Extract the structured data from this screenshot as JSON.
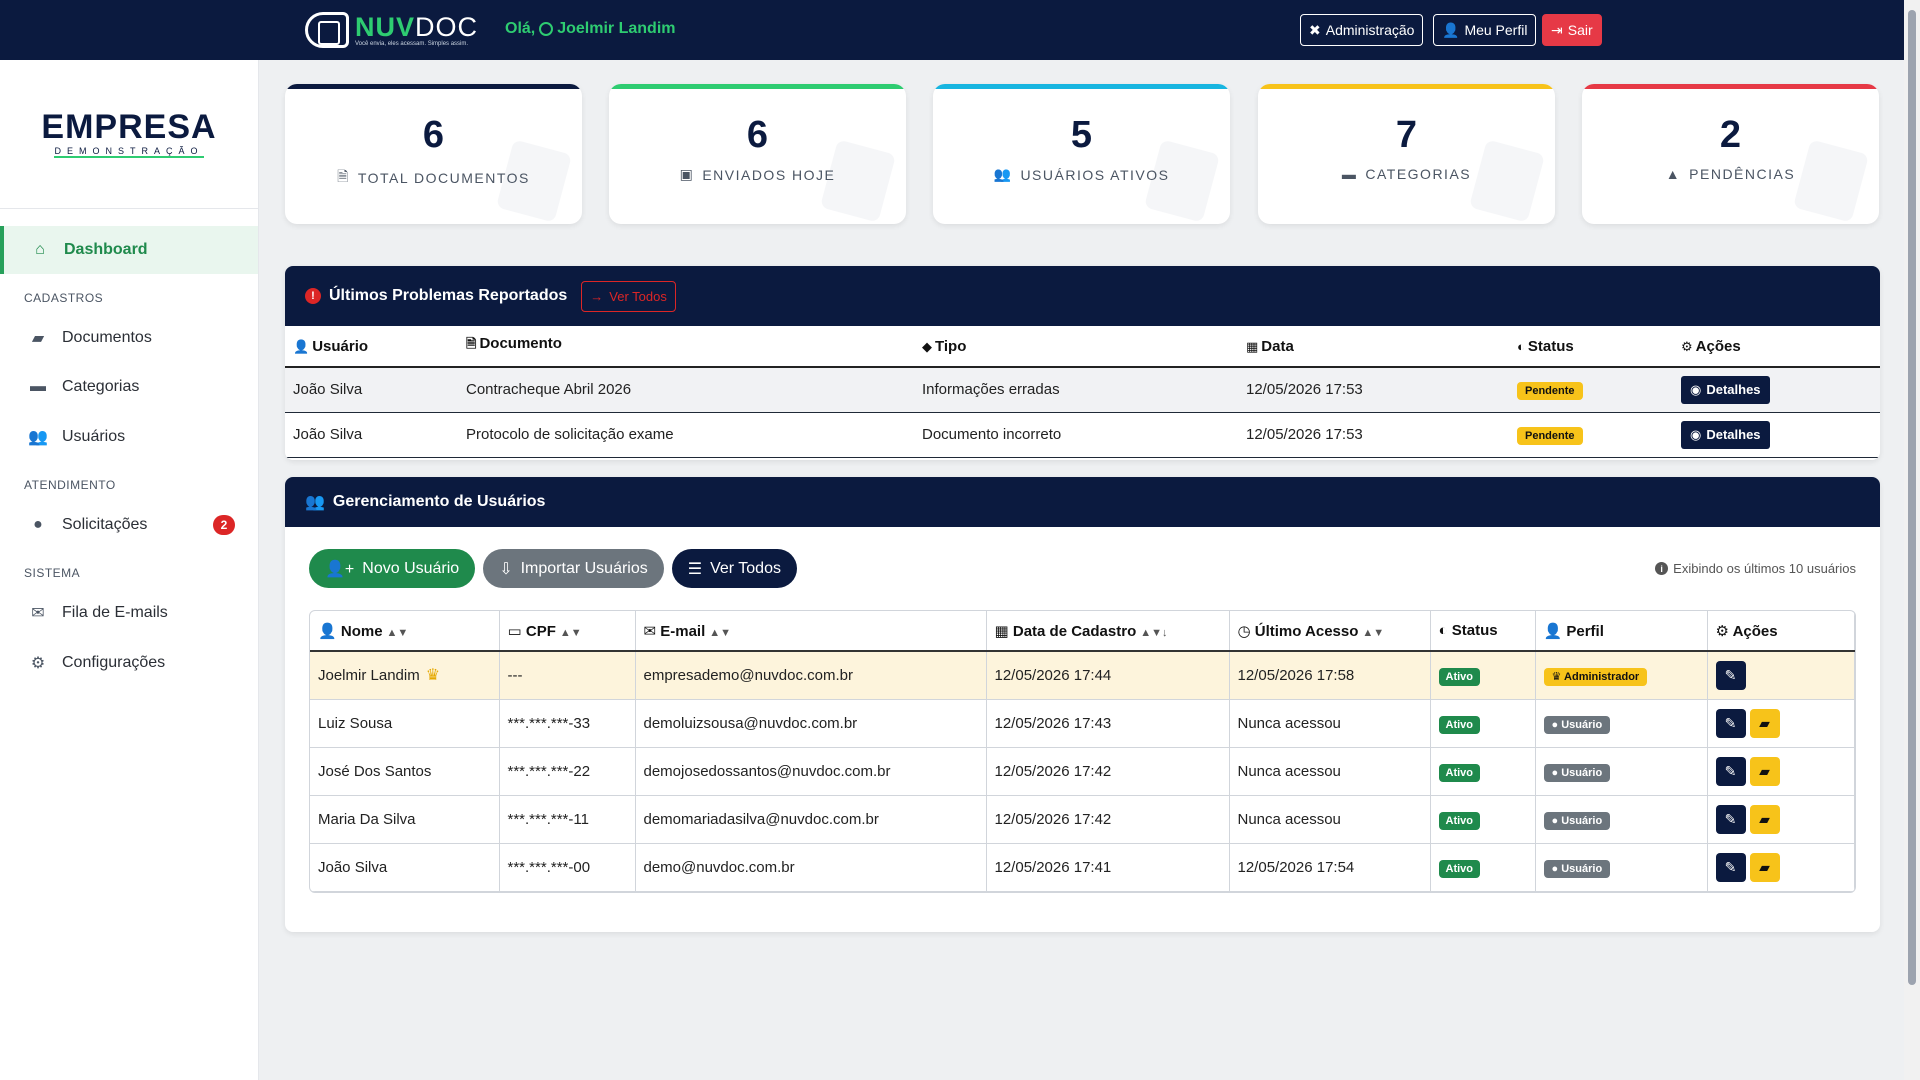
{
  "topbar": {
    "brand_nuv": "NUV",
    "brand_doc": "DOC",
    "tagline": "Você envia, eles acessam. Simples assim.",
    "greeting": "Olá, ",
    "username": "Joelmir Landim",
    "admin_label": "Administração",
    "profile_label": "Meu Perfil",
    "logout_label": "Sair"
  },
  "sidebar": {
    "company_name": "EMPRESA",
    "company_sub": "DEMONSTRAÇÃO",
    "dashboard": "Dashboard",
    "section_cadastros": "CADASTROS",
    "documentos": "Documentos",
    "categorias": "Categorias",
    "usuarios": "Usuários",
    "section_atendimento": "ATENDIMENTO",
    "solicitacoes": "Solicitações",
    "solicitacoes_badge": "2",
    "section_sistema": "SISTEMA",
    "fila_emails": "Fila de E-mails",
    "configuracoes": "Configurações"
  },
  "stats": [
    {
      "value": "6",
      "label": "TOTAL DOCUMENTOS",
      "color": "#0b1a3f",
      "icon": "file-icon"
    },
    {
      "value": "6",
      "label": "ENVIADOS HOJE",
      "color": "#2ecc71",
      "icon": "calendar-check-icon"
    },
    {
      "value": "5",
      "label": "USUÁRIOS ATIVOS",
      "color": "#17b5e0",
      "icon": "users-icon"
    },
    {
      "value": "7",
      "label": "CATEGORIAS",
      "color": "#f7c31a",
      "icon": "folder-icon"
    },
    {
      "value": "2",
      "label": "PENDÊNCIAS",
      "color": "#e63946",
      "icon": "warning-icon"
    }
  ],
  "problems": {
    "title": "Últimos Problemas Reportados",
    "see_all": "Ver Todos",
    "headers": {
      "user": "Usuário",
      "doc": "Documento",
      "type": "Tipo",
      "date": "Data",
      "status": "Status",
      "actions": "Ações"
    },
    "rows": [
      {
        "user": "João Silva",
        "doc": "Contracheque Abril 2026",
        "type": "Informações erradas",
        "date": "12/05/2026 17:53",
        "status": "Pendente",
        "action": "Detalhes"
      },
      {
        "user": "João Silva",
        "doc": "Protocolo de solicitação exame",
        "type": "Documento incorreto",
        "date": "12/05/2026 17:53",
        "status": "Pendente",
        "action": "Detalhes"
      }
    ]
  },
  "users": {
    "title": "Gerenciamento de Usuários",
    "new_user": "Novo Usuário",
    "import_users": "Importar Usuários",
    "see_all": "Ver Todos",
    "info": "Exibindo os últimos 10 usuários",
    "headers": {
      "name": "Nome",
      "cpf": "CPF",
      "email": "E-mail",
      "created": "Data de Cadastro",
      "last": "Último Acesso",
      "status": "Status",
      "role": "Perfil",
      "actions": "Ações"
    },
    "rows": [
      {
        "name": "Joelmir Landim",
        "cpf": "---",
        "email": "empresademo@nuvdoc.com.br",
        "created": "12/05/2026 17:44",
        "last": "12/05/2026 17:58",
        "status": "Ativo",
        "role": "Administrador"
      },
      {
        "name": "Luiz Sousa",
        "cpf": "***.***.***-33",
        "email": "demoluizsousa@nuvdoc.com.br",
        "created": "12/05/2026 17:43",
        "last": "Nunca acessou",
        "status": "Ativo",
        "role": "Usuário"
      },
      {
        "name": "José Dos Santos",
        "cpf": "***.***.***-22",
        "email": "demojosedossantos@nuvdoc.com.br",
        "created": "12/05/2026 17:42",
        "last": "Nunca acessou",
        "status": "Ativo",
        "role": "Usuário"
      },
      {
        "name": "Maria Da Silva",
        "cpf": "***.***.***-11",
        "email": "demomariadasilva@nuvdoc.com.br",
        "created": "12/05/2026 17:42",
        "last": "Nunca acessou",
        "status": "Ativo",
        "role": "Usuário"
      },
      {
        "name": "João Silva",
        "cpf": "***.***.***-00",
        "email": "demo@nuvdoc.com.br",
        "created": "12/05/2026 17:41",
        "last": "12/05/2026 17:54",
        "status": "Ativo",
        "role": "Usuário"
      }
    ]
  }
}
